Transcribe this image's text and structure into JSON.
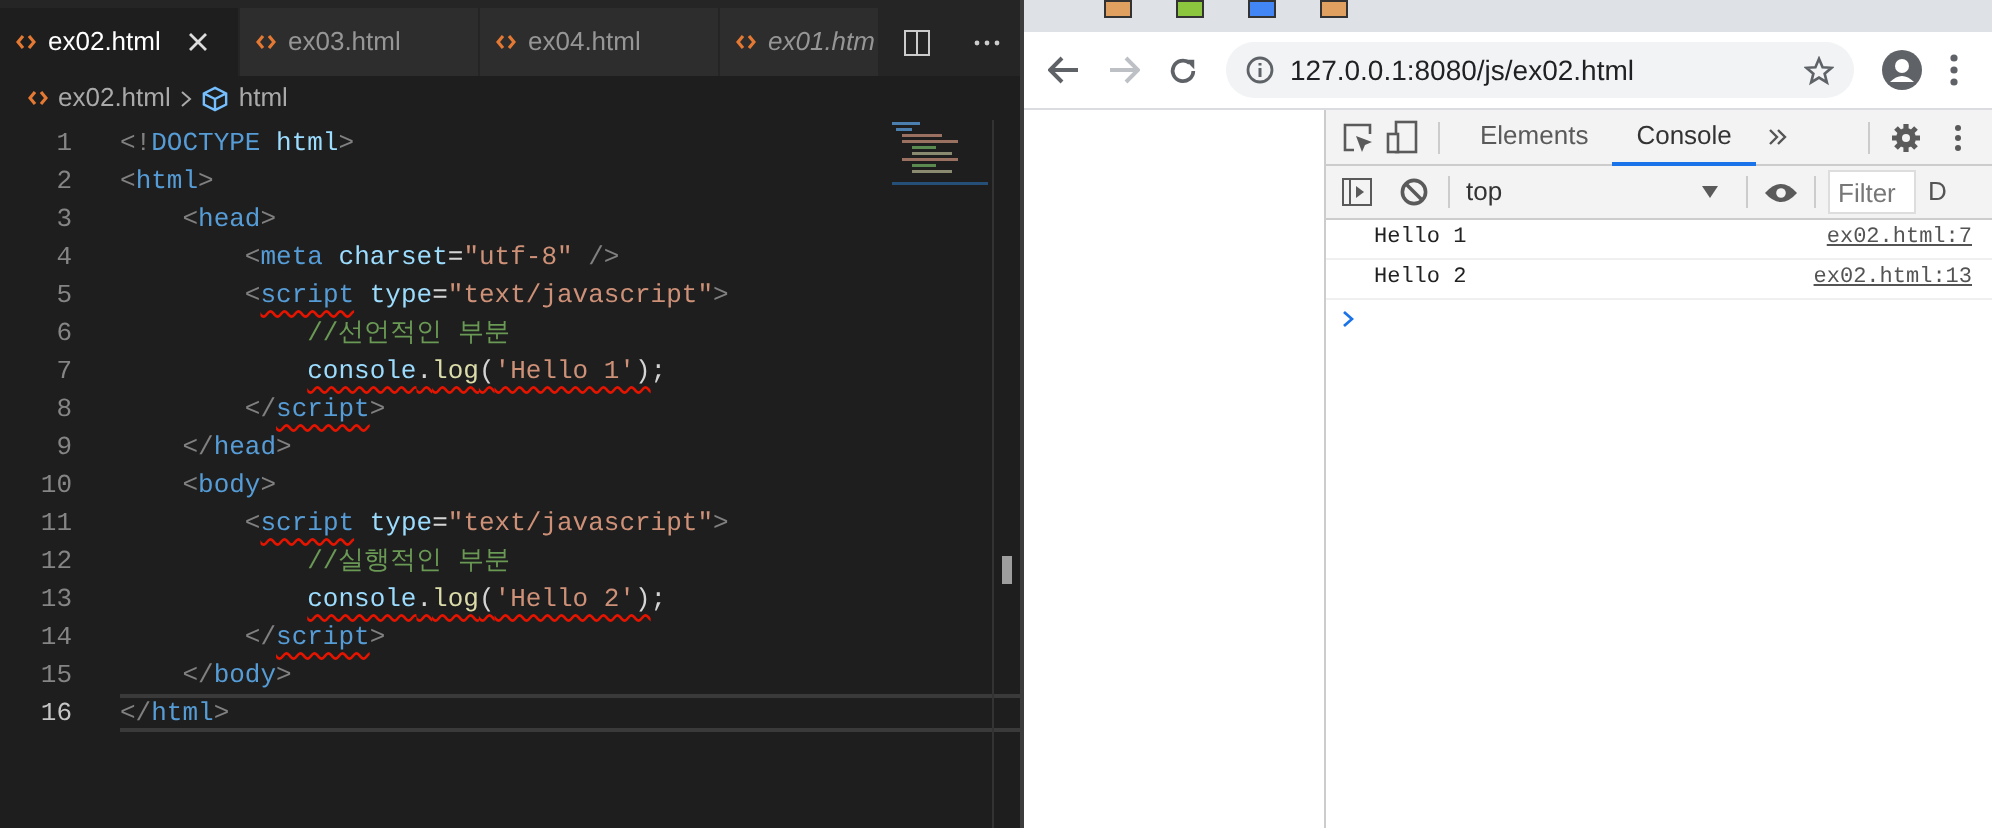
{
  "editor": {
    "tabs": [
      {
        "label": "ex02.html",
        "selected": true,
        "preview": false
      },
      {
        "label": "ex03.html",
        "selected": false,
        "preview": false
      },
      {
        "label": "ex04.html",
        "selected": false,
        "preview": false
      },
      {
        "label": "ex01.htm",
        "selected": false,
        "preview": true
      }
    ],
    "breadcrumbs": [
      {
        "label": "ex02.html",
        "kind": "file"
      },
      {
        "label": "html",
        "kind": "element"
      }
    ],
    "lines": [
      {
        "number": "1",
        "current": false,
        "tokens": [
          {
            "text": "<!",
            "kind": "punct"
          },
          {
            "text": "DOCTYPE",
            "kind": "tag"
          },
          {
            "text": " html",
            "kind": "attr"
          },
          {
            "text": ">",
            "kind": "punct"
          }
        ]
      },
      {
        "number": "2",
        "current": false,
        "tokens": [
          {
            "text": "<",
            "kind": "punct"
          },
          {
            "text": "html",
            "kind": "tag"
          },
          {
            "text": ">",
            "kind": "punct"
          }
        ]
      },
      {
        "number": "3",
        "current": false,
        "tokens": [
          {
            "text": "    <",
            "kind": "punct"
          },
          {
            "text": "head",
            "kind": "tag"
          },
          {
            "text": ">",
            "kind": "punct"
          }
        ]
      },
      {
        "number": "4",
        "current": false,
        "tokens": [
          {
            "text": "        <",
            "kind": "punct"
          },
          {
            "text": "meta",
            "kind": "tag"
          },
          {
            "text": " charset",
            "kind": "attr"
          },
          {
            "text": "=",
            "kind": "plain"
          },
          {
            "text": "\"utf-8\"",
            "kind": "string"
          },
          {
            "text": " />",
            "kind": "punct"
          }
        ]
      },
      {
        "number": "5",
        "current": false,
        "tokens": [
          {
            "text": "        <",
            "kind": "punct"
          },
          {
            "text": "script",
            "kind": "tag",
            "error": true
          },
          {
            "text": " type",
            "kind": "attr"
          },
          {
            "text": "=",
            "kind": "plain"
          },
          {
            "text": "\"text/javascript\"",
            "kind": "string"
          },
          {
            "text": ">",
            "kind": "punct"
          }
        ]
      },
      {
        "number": "6",
        "current": false,
        "tokens": [
          {
            "text": "            //선언적인 부분",
            "kind": "comment"
          }
        ]
      },
      {
        "number": "7",
        "current": false,
        "tokens": [
          {
            "text": "            console",
            "kind": "attr",
            "error": true
          },
          {
            "text": ".",
            "kind": "plain",
            "error": true
          },
          {
            "text": "log",
            "kind": "func",
            "error": true
          },
          {
            "text": "(",
            "kind": "plain",
            "error": true
          },
          {
            "text": "'Hello 1'",
            "kind": "string",
            "error": true
          },
          {
            "text": ")",
            "kind": "plain",
            "error": true
          },
          {
            "text": ";",
            "kind": "plain"
          }
        ]
      },
      {
        "number": "8",
        "current": false,
        "tokens": [
          {
            "text": "        </",
            "kind": "punct"
          },
          {
            "text": "script",
            "kind": "tag",
            "error": true
          },
          {
            "text": ">",
            "kind": "punct"
          }
        ]
      },
      {
        "number": "9",
        "current": false,
        "tokens": [
          {
            "text": "    </",
            "kind": "punct"
          },
          {
            "text": "head",
            "kind": "tag"
          },
          {
            "text": ">",
            "kind": "punct"
          }
        ]
      },
      {
        "number": "10",
        "current": false,
        "tokens": [
          {
            "text": "    <",
            "kind": "punct"
          },
          {
            "text": "body",
            "kind": "tag"
          },
          {
            "text": ">",
            "kind": "punct"
          }
        ]
      },
      {
        "number": "11",
        "current": false,
        "tokens": [
          {
            "text": "        <",
            "kind": "punct"
          },
          {
            "text": "script",
            "kind": "tag",
            "error": true
          },
          {
            "text": " type",
            "kind": "attr"
          },
          {
            "text": "=",
            "kind": "plain"
          },
          {
            "text": "\"text/javascript\"",
            "kind": "string"
          },
          {
            "text": ">",
            "kind": "punct"
          }
        ]
      },
      {
        "number": "12",
        "current": false,
        "tokens": [
          {
            "text": "            //실행적인 부분",
            "kind": "comment"
          }
        ]
      },
      {
        "number": "13",
        "current": false,
        "tokens": [
          {
            "text": "            console",
            "kind": "attr",
            "error": true
          },
          {
            "text": ".",
            "kind": "plain",
            "error": true
          },
          {
            "text": "log",
            "kind": "func",
            "error": true
          },
          {
            "text": "(",
            "kind": "plain",
            "error": true
          },
          {
            "text": "'Hello 2'",
            "kind": "string",
            "error": true
          },
          {
            "text": ")",
            "kind": "plain",
            "error": true
          },
          {
            "text": ";",
            "kind": "plain"
          }
        ]
      },
      {
        "number": "14",
        "current": false,
        "tokens": [
          {
            "text": "        </",
            "kind": "punct"
          },
          {
            "text": "script",
            "kind": "tag",
            "error": true
          },
          {
            "text": ">",
            "kind": "punct"
          }
        ]
      },
      {
        "number": "15",
        "current": false,
        "tokens": [
          {
            "text": "    </",
            "kind": "punct"
          },
          {
            "text": "body",
            "kind": "tag"
          },
          {
            "text": ">",
            "kind": "punct"
          }
        ]
      },
      {
        "number": "16",
        "current": true,
        "tokens": [
          {
            "text": "</",
            "kind": "punct"
          },
          {
            "text": "html",
            "kind": "tag"
          },
          {
            "text": ">",
            "kind": "punct"
          }
        ]
      }
    ]
  },
  "browser": {
    "address": "127.0.0.1:8080/js/ex02.html",
    "devtools": {
      "tabs": [
        {
          "label": "Elements",
          "selected": false
        },
        {
          "label": "Console",
          "selected": true
        }
      ],
      "context": "top",
      "filter_placeholder": "Filter",
      "levels": "D",
      "messages": [
        {
          "text": "Hello 1",
          "source": "ex02.html:7"
        },
        {
          "text": "Hello 2",
          "source": "ex02.html:13"
        }
      ]
    }
  }
}
